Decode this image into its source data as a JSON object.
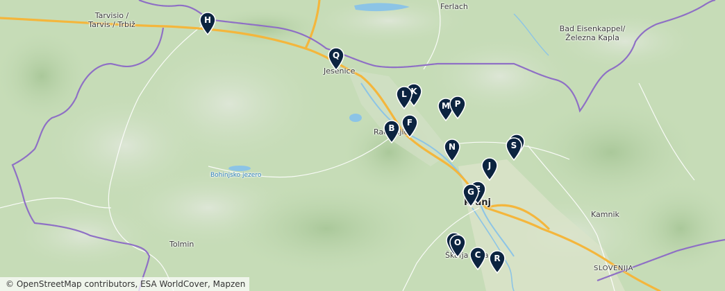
{
  "places": {
    "tarvisio": "Tarvisio /",
    "tarvisio2": "Tarvis / Trbiž",
    "ferlach": "Ferlach",
    "eisenkappel": "Bad Eisenkappel/",
    "eisenkappel2": "Železna Kapla",
    "jesenice": "Jesenice",
    "radovljica": "Radovljica",
    "bohinj_lake": "Bohinjsko jezero",
    "kranj": "Kranj",
    "tolmin": "Tolmin",
    "kamnik": "Kamnik",
    "skofja_loka": "Škofja Loka",
    "slovenija": "SLOVENIJA"
  },
  "markers": [
    "H",
    "Q",
    "L",
    "K",
    "M",
    "P",
    "B",
    "F",
    "N",
    "S",
    "T",
    "J",
    "G",
    "E",
    "O",
    "D",
    "C",
    "R"
  ],
  "attribution": {
    "copy": "©",
    "text": "OpenStreetMap contributors, ESA WorldCover, Mapzen"
  },
  "colors": {
    "marker_fill": "#0c2440",
    "border": "#8e6fc5",
    "highway": "#f4b63c",
    "water": "#8cc4e6"
  }
}
